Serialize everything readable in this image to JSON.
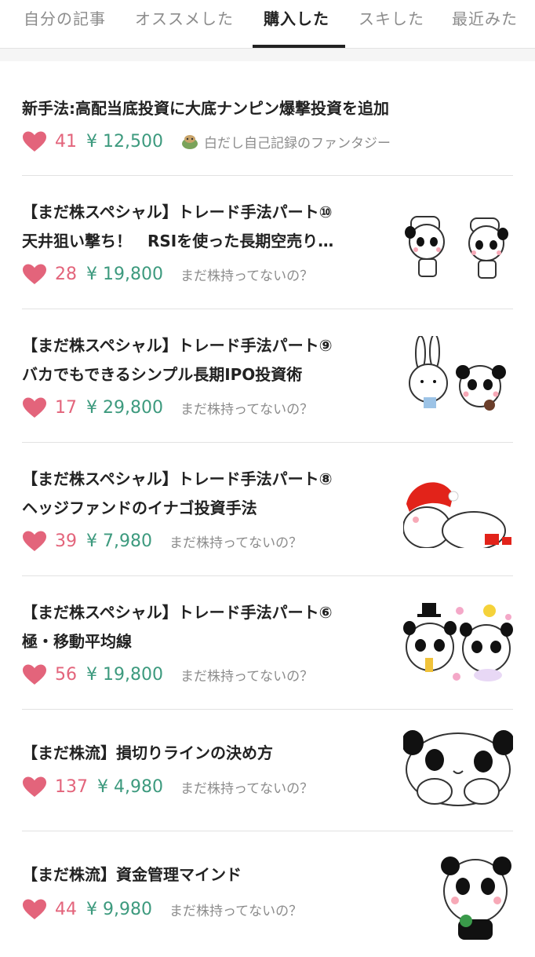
{
  "tabs": [
    {
      "label": "自分の記事",
      "active": false
    },
    {
      "label": "オススメした",
      "active": false
    },
    {
      "label": "購入した",
      "active": true
    },
    {
      "label": "スキした",
      "active": false
    },
    {
      "label": "最近みた",
      "active": false
    }
  ],
  "colors": {
    "heart": "#e3647b",
    "price": "#3d9a7e",
    "muted": "#8c8c8c"
  },
  "articles": [
    {
      "title": "新手法:高配当底投資に大底ナンピン爆撃投資を追加",
      "likes": "41",
      "price": "¥ 12,500",
      "author": "白だし自己記録のファンタジー"
    },
    {
      "title_lines": [
        "【まだ株スペシャル】トレード手法パート⑩",
        "天井狙い撃ち！　RSIを使った長期空売り…"
      ],
      "likes": "28",
      "price": "¥ 19,800",
      "author": "まだ株持ってないの？"
    },
    {
      "title_lines": [
        "【まだ株スペシャル】トレード手法パート⑨",
        "バカでもできるシンプル長期IPO投資術"
      ],
      "likes": "17",
      "price": "¥ 29,800",
      "author": "まだ株持ってないの？"
    },
    {
      "title_lines": [
        "【まだ株スペシャル】トレード手法パート⑧",
        "ヘッジファンドのイナゴ投資手法"
      ],
      "likes": "39",
      "price": "¥ 7,980",
      "author": "まだ株持ってないの？"
    },
    {
      "title_lines": [
        "【まだ株スペシャル】トレード手法パート⑥",
        "極・移動平均線"
      ],
      "likes": "56",
      "price": "¥ 19,800",
      "author": "まだ株持ってないの？"
    },
    {
      "title": "【まだ株流】損切りラインの決め方",
      "likes": "137",
      "price": "¥ 4,980",
      "author": "まだ株持ってないの？"
    },
    {
      "title": "【まだ株流】資金管理マインド",
      "likes": "44",
      "price": "¥ 9,980",
      "author": "まだ株持ってないの？"
    }
  ]
}
